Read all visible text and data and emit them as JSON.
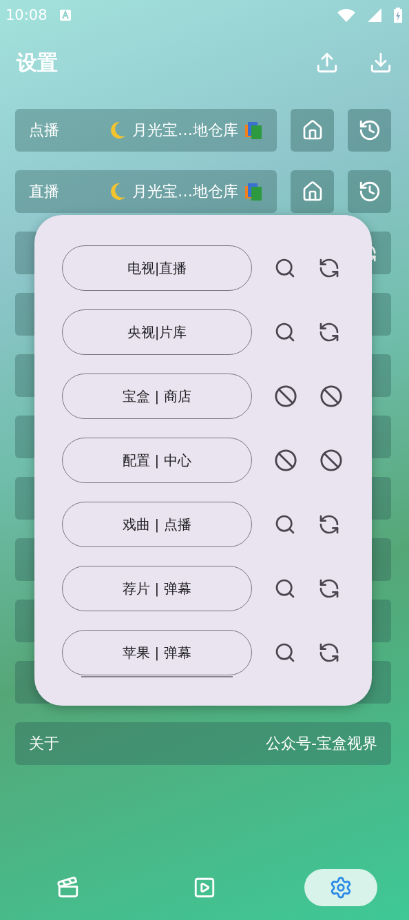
{
  "status_bar": {
    "time": "10:08"
  },
  "header": {
    "title": "设置"
  },
  "source_rows": [
    {
      "label": "点播",
      "value": "月光宝…地仓库"
    },
    {
      "label": "直播",
      "value": "月光宝…地仓库"
    }
  ],
  "settings_rows": [
    {
      "kind": "refresh"
    },
    {
      "kind": "plain"
    },
    {
      "kind": "plain"
    },
    {
      "kind": "plain"
    },
    {
      "kind": "plain"
    },
    {
      "kind": "plain"
    },
    {
      "kind": "plain"
    },
    {
      "kind": "plain"
    },
    {
      "label": "关于",
      "value": "公众号-宝盒视界",
      "kind": "plain"
    }
  ],
  "dialog": {
    "items": [
      {
        "label": "电视|直播",
        "enabled": true
      },
      {
        "label": "央视|片库",
        "enabled": true
      },
      {
        "label": "宝盒 | 商店",
        "enabled": false
      },
      {
        "label": "配置 | 中心",
        "enabled": false
      },
      {
        "label": "戏曲 | 点播",
        "enabled": true
      },
      {
        "label": "荐片 | 弹幕",
        "enabled": true
      },
      {
        "label": "苹果 | 弹幕",
        "enabled": true
      }
    ]
  },
  "nav": [
    {
      "kind": "movies",
      "selected": false
    },
    {
      "kind": "play",
      "selected": false
    },
    {
      "kind": "settings",
      "selected": true
    }
  ]
}
